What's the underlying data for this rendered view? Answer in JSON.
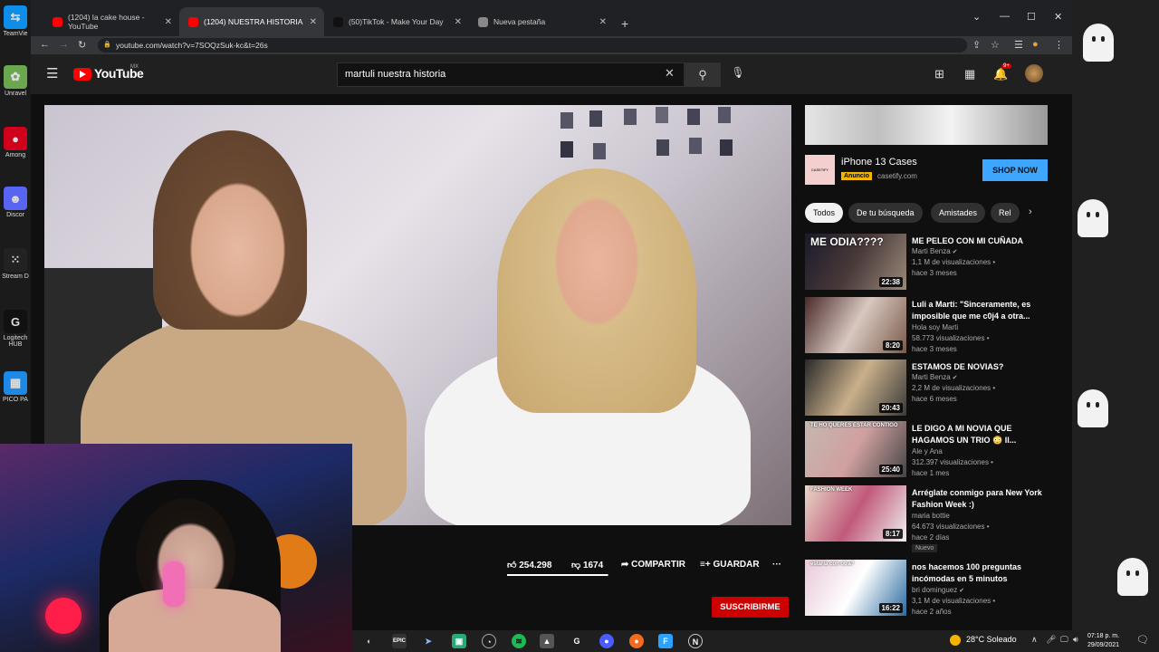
{
  "desktop": {
    "icons": [
      {
        "label": "TeamVie",
        "glyph": "⇆",
        "color": "#0e8ee9"
      },
      {
        "label": "Unravel",
        "glyph": "✿",
        "color": "#6aa84f"
      },
      {
        "label": "Among",
        "glyph": "●",
        "color": "#d0021b"
      },
      {
        "label": "Discor",
        "glyph": "☻",
        "color": "#5865f2"
      },
      {
        "label": "Stream D",
        "glyph": "⁙",
        "color": "#222"
      },
      {
        "label": "Logitech HUB",
        "glyph": "G",
        "color": "#111"
      },
      {
        "label": "PICO PA",
        "glyph": "▦",
        "color": "#1e88e5"
      }
    ]
  },
  "browser": {
    "tabs": [
      {
        "title": "(1204) la cake house - YouTube",
        "icon": "youtube-icon",
        "active": false
      },
      {
        "title": "(1204) NUESTRA HISTORIA",
        "icon": "youtube-icon",
        "active": true
      },
      {
        "title": "(50)TikTok - Make Your Day",
        "icon": "tiktok-icon",
        "active": false
      },
      {
        "title": "Nueva pestaña",
        "icon": "globe-icon",
        "active": false
      }
    ],
    "url": "youtube.com/watch?v=7SOQzSuk-kc&t=26s"
  },
  "youtube": {
    "logo_text": "YouTube",
    "country_code": "MX",
    "search_query": "martuli nuestra historia",
    "notification_count": "9+",
    "actions": {
      "likes": "254.298",
      "dislikes": "1674",
      "share": "COMPARTIR",
      "save": "GUARDAR",
      "more": "···"
    },
    "like_ratio": 0.99,
    "subscribe": "SUSCRIBIRME"
  },
  "ad": {
    "title": "iPhone 13 Cases",
    "badge": "Anuncio",
    "domain": "casetify.com",
    "logo_text": "CASETiFY",
    "cta": "SHOP NOW"
  },
  "chips": [
    "Todos",
    "De tu búsqueda",
    "Amistades",
    "Rel"
  ],
  "recommendations": [
    {
      "title": "ME PELEO CON MI CUÑADA",
      "channel": "Marti Benza",
      "verified": true,
      "views": "1,1 M de visualizaciones",
      "age": "hace 3 meses",
      "duration": "22:38",
      "thumb_text": "ME ODIA????",
      "badge": ""
    },
    {
      "title": "Luli a Marti: \"Sinceramente, es imposible que me c0j4 a otra...",
      "channel": "Hola soy Marti",
      "verified": false,
      "views": "58.773 visualizaciones",
      "age": "hace 3 meses",
      "duration": "8:20",
      "thumb_text": "",
      "badge": ""
    },
    {
      "title": "ESTAMOS DE NOVIAS?",
      "channel": "Marti Benza",
      "verified": true,
      "views": "2,2 M de visualizaciones",
      "age": "hace 6 meses",
      "duration": "20:43",
      "thumb_text": "",
      "badge": ""
    },
    {
      "title": "LE DIGO A MI NOVIA QUE HAGAMOS UN TRIO 😳 ll...",
      "channel": "Ale y Ana",
      "verified": false,
      "views": "312.397 visualizaciones",
      "age": "hace 1 mes",
      "duration": "25:40",
      "thumb_text": "TE HO QUERES ESTAR CONTIGO",
      "badge": ""
    },
    {
      "title": "Arréglate conmigo para New York Fashion Week :)",
      "channel": "maria bottie",
      "verified": false,
      "views": "64.673 visualizaciones",
      "age": "hace 2 días",
      "duration": "8:17",
      "thumb_text": "FASHION WEEK",
      "badge": "Nuevo"
    },
    {
      "title": "nos hacemos 100 preguntas incómodas en 5 minutos",
      "channel": "bri dominguez",
      "verified": true,
      "views": "3,1 M de visualizaciones",
      "age": "hace 2 años",
      "duration": "16:22",
      "thumb_text": "estaria con otra?",
      "badge": ""
    }
  ],
  "taskbar": {
    "weather": "28°C Soleado",
    "time": "07:18 p. m.",
    "date": "29/09/2021"
  }
}
